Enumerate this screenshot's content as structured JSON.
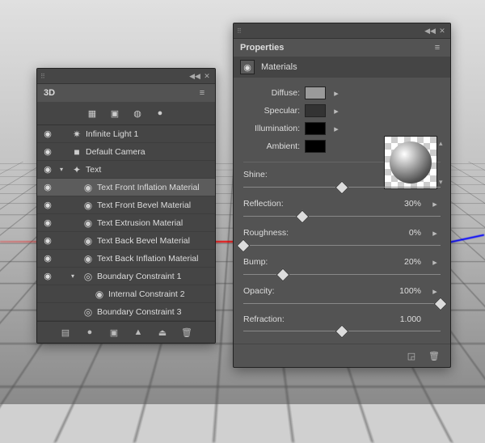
{
  "panel3d": {
    "title": "3D",
    "layers": [
      {
        "eye": true,
        "indent": 0,
        "twisty": "",
        "icon": "✷",
        "label": "Infinite Light 1",
        "sel": false
      },
      {
        "eye": true,
        "indent": 0,
        "twisty": "",
        "icon": "■",
        "label": "Default Camera",
        "sel": false
      },
      {
        "eye": true,
        "indent": 0,
        "twisty": "▾",
        "icon": "✦",
        "label": "Text",
        "sel": false
      },
      {
        "eye": true,
        "indent": 1,
        "twisty": "",
        "icon": "◉",
        "label": "Text Front Inflation Material",
        "sel": true
      },
      {
        "eye": true,
        "indent": 1,
        "twisty": "",
        "icon": "◉",
        "label": "Text Front Bevel Material",
        "sel": false
      },
      {
        "eye": true,
        "indent": 1,
        "twisty": "",
        "icon": "◉",
        "label": "Text Extrusion Material",
        "sel": false
      },
      {
        "eye": true,
        "indent": 1,
        "twisty": "",
        "icon": "◉",
        "label": "Text Back Bevel Material",
        "sel": false
      },
      {
        "eye": true,
        "indent": 1,
        "twisty": "",
        "icon": "◉",
        "label": "Text Back Inflation Material",
        "sel": false
      },
      {
        "eye": true,
        "indent": 1,
        "twisty": "▾",
        "icon": "◎",
        "label": "Boundary Constraint 1",
        "sel": false
      },
      {
        "eye": false,
        "indent": 2,
        "twisty": "",
        "icon": "◉",
        "label": "Internal Constraint 2",
        "sel": false
      },
      {
        "eye": false,
        "indent": 1,
        "twisty": "",
        "icon": "◎",
        "label": "Boundary Constraint 3",
        "sel": false
      }
    ]
  },
  "props": {
    "title": "Properties",
    "subhead": "Materials",
    "swatches": [
      {
        "label": "Diffuse:",
        "color": "#9a9a9a",
        "btn": true
      },
      {
        "label": "Specular:",
        "color": "#333333",
        "btn": true
      },
      {
        "label": "Illumination:",
        "color": "#000000",
        "btn": true
      },
      {
        "label": "Ambient:",
        "color": "#000000",
        "btn": false
      }
    ],
    "sliders": [
      {
        "label": "Shine:",
        "value": "50%",
        "pos": 50,
        "btn": true
      },
      {
        "label": "Reflection:",
        "value": "30%",
        "pos": 30,
        "btn": true
      },
      {
        "label": "Roughness:",
        "value": "0%",
        "pos": 0,
        "btn": true
      },
      {
        "label": "Bump:",
        "value": "20%",
        "pos": 20,
        "btn": true
      },
      {
        "label": "Opacity:",
        "value": "100%",
        "pos": 100,
        "btn": true
      },
      {
        "label": "Refraction:",
        "value": "1.000",
        "pos": 50,
        "btn": false
      }
    ]
  }
}
